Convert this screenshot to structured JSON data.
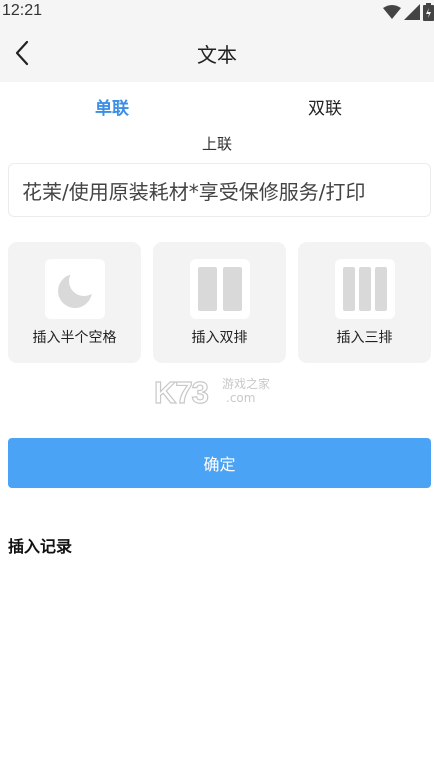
{
  "status_bar": {
    "time": "12:21",
    "icons": [
      "wifi-icon",
      "signal-icon",
      "battery-icon"
    ]
  },
  "header": {
    "title": "文本",
    "back_icon": "back-chevron-icon"
  },
  "tabs": [
    {
      "label": "单联",
      "selected": true
    },
    {
      "label": "双联",
      "selected": false
    }
  ],
  "sub_label": "上联",
  "text_input": {
    "value": "花茉/使用原装耗材*享受保修服务/打印"
  },
  "insert_options": [
    {
      "label": "插入半个空格",
      "icon": "moon-icon"
    },
    {
      "label": "插入双排",
      "icon": "two-columns-icon"
    },
    {
      "label": "插入三排",
      "icon": "three-columns-icon"
    }
  ],
  "watermark": {
    "brand": "K73",
    "text_top": "游戏之家",
    "text_bottom": ".com"
  },
  "confirm_label": "确定",
  "history_title": "插入记录",
  "colors": {
    "accent": "#3a8ee6",
    "button": "#4ba3f5",
    "card_bg": "#f3f3f3",
    "bar_bg": "#f5f5f5"
  }
}
